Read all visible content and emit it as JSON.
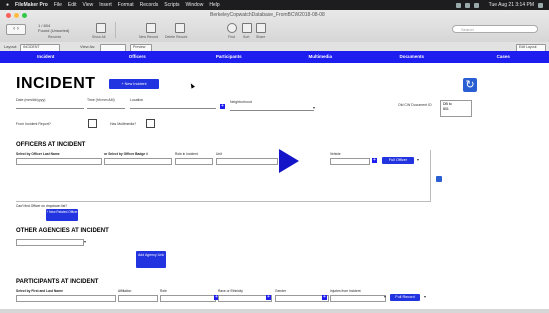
{
  "menubar": {
    "apple": "●",
    "items": [
      "FileMaker Pro",
      "File",
      "Edit",
      "View",
      "Insert",
      "Format",
      "Records",
      "Scripts",
      "Window",
      "Help"
    ],
    "clock": "Tue Aug 21  3:14 PM"
  },
  "window": {
    "title": "BerkeleyCopwatchDatabase_FromBCW2018-08-08"
  },
  "toolbar": {
    "record_info": "1 / 804",
    "record_sub": "Found (Unsorted)",
    "labels": [
      "Records",
      "Show All",
      "New Record",
      "Delete Record",
      "Find",
      "Sort",
      "Share"
    ],
    "search_placeholder": "Search"
  },
  "layoutbar": {
    "layout_label": "Layout:",
    "layout_value": "INCIDENT",
    "view_label": "View As:",
    "preview": "Preview",
    "edit_layout": "Edit Layout"
  },
  "tabs": [
    "Incident",
    "Officers",
    "Participants",
    "Multimedia",
    "Documents",
    "Cases"
  ],
  "incident": {
    "title": "INCIDENT",
    "new_button": "+ New Incident",
    "date_label": "Date (mm/dd/yyyy)",
    "time_label": "Time (hh:mm AM)",
    "location_label": "Location",
    "neighborhood_label": "Neighborhood",
    "old_cw_label": "Old CW Document ID",
    "old_cw_value_1": "DB to",
    "old_cw_value_2": "801",
    "from_report_label": "From Incident Report?",
    "has_multimedia_label": "Has Multimedia?"
  },
  "officers": {
    "title": "OFFICERS AT INCIDENT",
    "select_name": "Select by Officer Last Name",
    "select_badge": "or  Select by Officer Badge #",
    "role_label": "Role in Incident",
    "unit_label": "Unit",
    "vehicle_label": "Vehicle",
    "full_officer": "Full Officer",
    "cant_find": "Can't find Officer on dropdown list?",
    "new_related": "+ New Related Officer"
  },
  "agencies": {
    "title": "OTHER AGENCIES AT INCIDENT",
    "add_button": "Add Agency Link"
  },
  "participants": {
    "title": "PARTICIPANTS AT INCIDENT",
    "cols": [
      "Select by First and Last Name",
      "Affiliation",
      "Role",
      "Race or Ethnicity",
      "Gender",
      "Injuries from Incident"
    ],
    "full_record": "Full Record"
  },
  "colors": {
    "tab_blue": "#1d1df0",
    "button_blue": "#2233e0",
    "refresh_blue": "#2a5fd4"
  }
}
